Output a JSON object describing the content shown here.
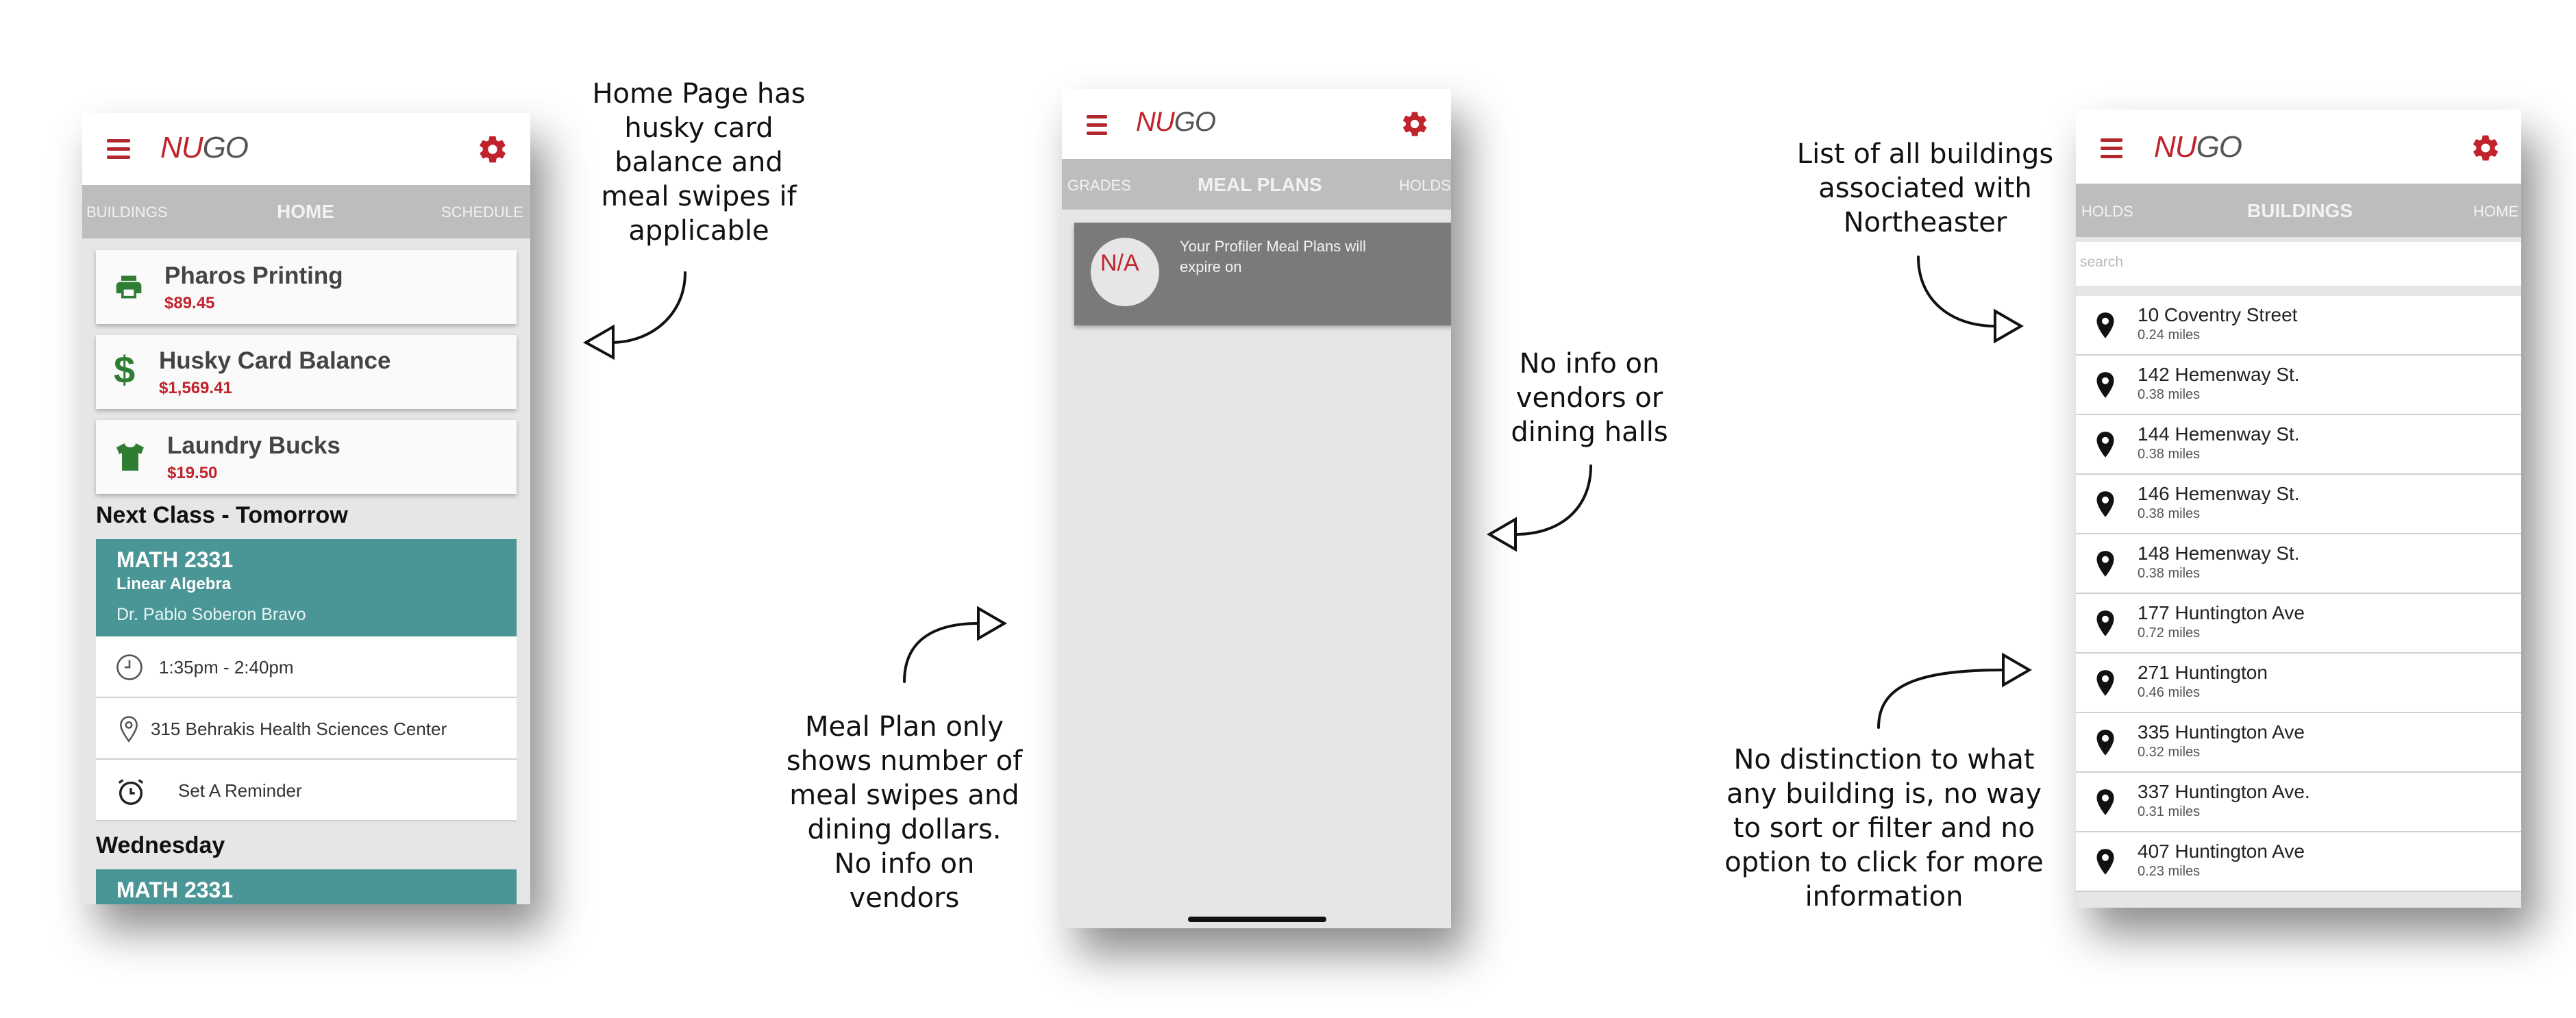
{
  "app": {
    "logo_nu": "NU",
    "logo_go": "GO"
  },
  "home": {
    "tabs": {
      "left": "BUILDINGS",
      "active": "HOME",
      "right": "SCHEDULE"
    },
    "cards": [
      {
        "title": "Pharos Printing",
        "value": "$89.45",
        "icon": "printer-icon"
      },
      {
        "title": "Husky Card Balance",
        "value": "$1,569.41",
        "icon": "dollar-icon"
      },
      {
        "title": "Laundry Bucks",
        "value": "$19.50",
        "icon": "tshirt-icon"
      }
    ],
    "next_class_heading": "Next Class - Tomorrow",
    "next_class": {
      "code": "MATH 2331",
      "name": "Linear Algebra",
      "instructor": "Dr. Pablo Soberon Bravo"
    },
    "details": {
      "time": "1:35pm - 2:40pm",
      "location": "315 Behrakis Health Sciences Center",
      "reminder": "Set A Reminder"
    },
    "wednesday_heading": "Wednesday",
    "wednesday_class": {
      "code": "MATH 2331"
    }
  },
  "meal": {
    "tabs": {
      "left": "GRADES",
      "active": "MEAL PLANS",
      "right": "HOLDS"
    },
    "badge": "N/A",
    "text": "Your Profiler Meal Plans will expire on"
  },
  "buildings": {
    "tabs": {
      "left": "HOLDS",
      "active": "BUILDINGS",
      "right": "HOME"
    },
    "search_placeholder": "search",
    "items": [
      {
        "name": "10 Coventry Street",
        "dist": "0.24 miles"
      },
      {
        "name": "142 Hemenway St.",
        "dist": "0.38 miles"
      },
      {
        "name": "144 Hemenway St.",
        "dist": "0.38 miles"
      },
      {
        "name": "146 Hemenway St.",
        "dist": "0.38 miles"
      },
      {
        "name": "148 Hemenway St.",
        "dist": "0.38 miles"
      },
      {
        "name": "177 Huntington Ave",
        "dist": "0.72 miles"
      },
      {
        "name": "271 Huntington",
        "dist": "0.46 miles"
      },
      {
        "name": "335 Huntington Ave",
        "dist": "0.32 miles"
      },
      {
        "name": "337 Huntington Ave.",
        "dist": "0.31 miles"
      },
      {
        "name": "407 Huntington Ave",
        "dist": "0.23 miles"
      }
    ]
  },
  "annotations": {
    "home": "Home Page has\nhusky card\nbalance and\nmeal swipes if\napplicable",
    "meal_plan": "Meal Plan only\nshows number of\nmeal swipes and\ndining dollars.\nNo info on\nvendors",
    "vendors": "No info on\nvendors or\ndining halls",
    "list": "List of all buildings\nassociated with\nNortheaster",
    "distinction": "No distinction to what\nany building is, no way\nto sort or filter and no\noption to click for more\ninformation"
  },
  "colors": {
    "brand_red": "#c0232c",
    "teal": "#4a9696",
    "tab_gray": "#bdbdbd",
    "icon_green": "#2e7d32"
  }
}
